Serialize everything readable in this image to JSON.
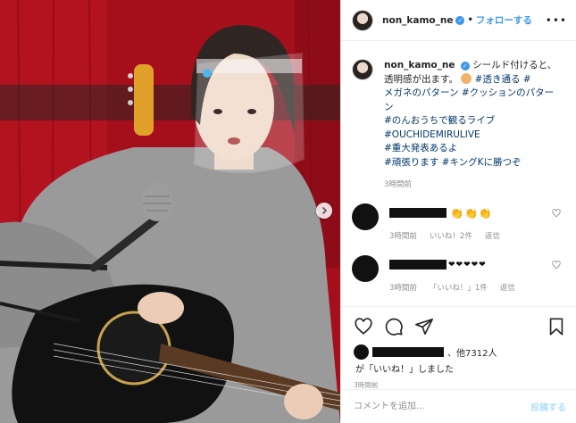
{
  "post": {
    "image_alt": "",
    "header": {
      "username": "non_kamo_ne",
      "separator": "•",
      "follow_label": "フォローする",
      "more_label": "•••"
    },
    "caption": {
      "username": "non_kamo_ne",
      "line1": "シールド付けると、",
      "line2": "透明感が出ます。",
      "tag1": "#透き通る",
      "tag2": "#",
      "line3": "メガネのパターン",
      "tag3": "#クッションのパター",
      "line4": "ン",
      "tag4": "#のんおうちで観るライブ",
      "tag5": "#OUCHIDEMIRULIVE",
      "tag6": "#重大発表あるよ",
      "tag7": "#頑張ります",
      "tag8": "#キングKに勝つぞ",
      "time": "3時間前"
    },
    "comments": [
      {
        "emoji": "👏👏👏",
        "time": "3時間前",
        "likes": "いいね！2件",
        "reply": "返信"
      },
      {
        "emoji": "❤❤❤❤❤",
        "time": "3時間前",
        "likes": "「いいね！」1件",
        "reply": "返信"
      }
    ],
    "likes": {
      "suffix": "、他7312人",
      "line2": "が「いいね！」しました"
    },
    "time": "3時間前",
    "comment_box": {
      "placeholder": "コメントを追加...",
      "post_label": "投稿する"
    }
  },
  "colors": {
    "accent": "#3897f0",
    "hashtag": "#00376b",
    "muted": "#8e8e8e",
    "border": "#efefef",
    "post_button_disabled": "#b2dffc"
  }
}
